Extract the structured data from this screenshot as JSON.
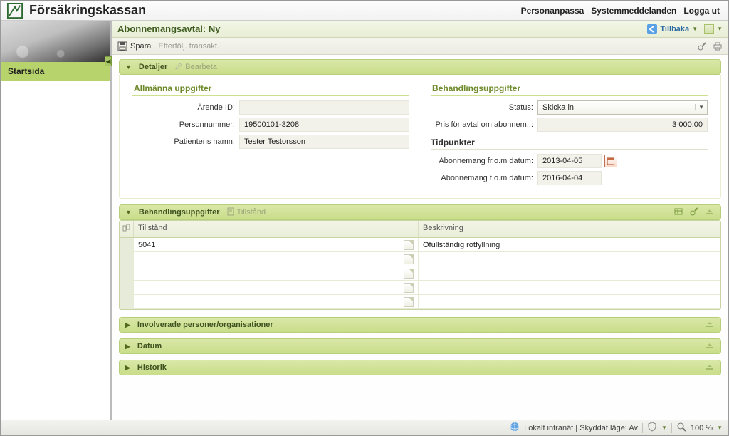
{
  "brand": "Försäkringskassan",
  "top_links": {
    "personalize": "Personanpassa",
    "sysmsg": "Systemmeddelanden",
    "logout": "Logga ut"
  },
  "sidebar": {
    "item0": "Startsida"
  },
  "page": {
    "title": "Abonnemangsavtal: Ny",
    "back": "Tillbaka"
  },
  "toolbar": {
    "save": "Spara",
    "followup": "Efterfölj. transakt."
  },
  "detaljer": {
    "panel_label": "Detaljer",
    "edit_label": "Bearbeta",
    "general_title": "Allmänna uppgifter",
    "arende_label": "Ärende ID:",
    "arende_value": "",
    "personnr_label": "Personnummer:",
    "personnr_value": "19500101-3208",
    "patient_label": "Patientens namn:",
    "patient_value": "Tester Testorsson",
    "treat_title": "Behandlingsuppgifter",
    "status_label": "Status:",
    "status_value": "Skicka in",
    "price_label": "Pris för avtal om abonnem..:",
    "price_value": "3 000,00",
    "time_title": "Tidpunkter",
    "from_label": "Abonnemang fr.o.m datum:",
    "from_value": "2013-04-05",
    "to_label": "Abonnemang t.o.m datum:",
    "to_value": "2016-04-04"
  },
  "behand": {
    "panel_label": "Behandlingsuppgifter",
    "tillstand_btn": "Tillstånd",
    "col_tillstand": "Tillstånd",
    "col_beskriv": "Beskrivning",
    "rows": [
      {
        "t": "5041",
        "b": "Ofullständig rotfyllning"
      },
      {
        "t": "",
        "b": ""
      },
      {
        "t": "",
        "b": ""
      },
      {
        "t": "",
        "b": ""
      },
      {
        "t": "",
        "b": ""
      }
    ]
  },
  "panels": {
    "involverade": "Involverade personer/organisationer",
    "datum": "Datum",
    "historik": "Historik"
  },
  "status": {
    "zone": "Lokalt intranät | Skyddat läge: Av",
    "zoom": "100 %"
  }
}
